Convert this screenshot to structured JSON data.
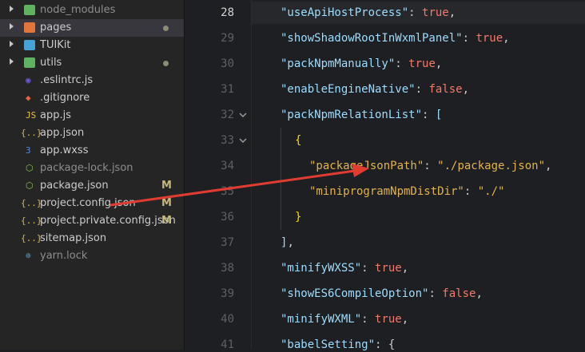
{
  "explorer": {
    "items": [
      {
        "name": "node_modules",
        "kind": "folder",
        "icon": "folder-green-icon",
        "muted": true,
        "expandable": true
      },
      {
        "name": "pages",
        "kind": "folder",
        "icon": "folder-orange-icon",
        "selected": true,
        "expandable": true,
        "dot": true
      },
      {
        "name": "TUIKit",
        "kind": "folder",
        "icon": "folder-blue-icon",
        "expandable": true
      },
      {
        "name": "utils",
        "kind": "folder",
        "icon": "folder-green-icon",
        "expandable": true,
        "dot": true
      },
      {
        "name": ".eslintrc.js",
        "kind": "file",
        "icon": "eslint-icon"
      },
      {
        "name": ".gitignore",
        "kind": "file",
        "icon": "git-icon"
      },
      {
        "name": "app.js",
        "kind": "file",
        "icon": "js-icon"
      },
      {
        "name": "app.json",
        "kind": "file",
        "icon": "json-icon"
      },
      {
        "name": "app.wxss",
        "kind": "file",
        "icon": "css-icon"
      },
      {
        "name": "package-lock.json",
        "kind": "file",
        "icon": "npm-icon",
        "muted": true
      },
      {
        "name": "package.json",
        "kind": "file",
        "icon": "npm-icon",
        "badge": "M"
      },
      {
        "name": "project.config.json",
        "kind": "file",
        "icon": "json-icon",
        "badge": "M"
      },
      {
        "name": "project.private.config.json",
        "kind": "file",
        "icon": "json-icon",
        "badge": "M"
      },
      {
        "name": "sitemap.json",
        "kind": "file",
        "icon": "json-icon"
      },
      {
        "name": "yarn.lock",
        "kind": "file",
        "icon": "yarn-icon",
        "muted": true
      }
    ]
  },
  "editor": {
    "current_line": "28",
    "line_numbers": [
      "28",
      "29",
      "30",
      "31",
      "32",
      "33",
      "34",
      "35",
      "36",
      "37",
      "38",
      "39",
      "40",
      "41"
    ],
    "fold_markers_at": [
      "32",
      "33"
    ],
    "lines": [
      {
        "indent": 0,
        "tokens": [
          {
            "t": "\"useApiHostProcess\"",
            "c": "k"
          },
          {
            "t": ": ",
            "c": "p"
          },
          {
            "t": "true",
            "c": "b"
          },
          {
            "t": ",",
            "c": "p"
          }
        ]
      },
      {
        "indent": 0,
        "tokens": [
          {
            "t": "\"showShadowRootInWxmlPanel\"",
            "c": "k"
          },
          {
            "t": ": ",
            "c": "p"
          },
          {
            "t": "true",
            "c": "b"
          },
          {
            "t": ",",
            "c": "p"
          }
        ]
      },
      {
        "indent": 0,
        "tokens": [
          {
            "t": "\"packNpmManually\"",
            "c": "k"
          },
          {
            "t": ": ",
            "c": "p"
          },
          {
            "t": "true",
            "c": "b"
          },
          {
            "t": ",",
            "c": "p"
          }
        ]
      },
      {
        "indent": 0,
        "tokens": [
          {
            "t": "\"enableEngineNative\"",
            "c": "k"
          },
          {
            "t": ": ",
            "c": "p"
          },
          {
            "t": "false",
            "c": "b"
          },
          {
            "t": ",",
            "c": "p"
          }
        ]
      },
      {
        "indent": 0,
        "tokens": [
          {
            "t": "\"packNpmRelationList\"",
            "c": "k"
          },
          {
            "t": ": ",
            "c": "p"
          },
          {
            "t": "[",
            "c": "k"
          }
        ]
      },
      {
        "indent": 1,
        "tokens": [
          {
            "t": "{",
            "c": "br"
          }
        ]
      },
      {
        "indent": 2,
        "tokens": [
          {
            "t": "\"packageJsonPath\"",
            "c": "sk"
          },
          {
            "t": ": ",
            "c": "p"
          },
          {
            "t": "\"./package.json\"",
            "c": "s"
          },
          {
            "t": ",",
            "c": "p"
          }
        ]
      },
      {
        "indent": 2,
        "tokens": [
          {
            "t": "\"miniprogramNpmDistDir\"",
            "c": "sk"
          },
          {
            "t": ": ",
            "c": "p"
          },
          {
            "t": "\"./\"",
            "c": "s"
          }
        ]
      },
      {
        "indent": 1,
        "tokens": [
          {
            "t": "}",
            "c": "br"
          }
        ]
      },
      {
        "indent": 0,
        "tokens": [
          {
            "t": "]",
            "c": "k"
          },
          {
            "t": ",",
            "c": "p"
          }
        ]
      },
      {
        "indent": 0,
        "tokens": [
          {
            "t": "\"minifyWXSS\"",
            "c": "k"
          },
          {
            "t": ": ",
            "c": "p"
          },
          {
            "t": "true",
            "c": "b"
          },
          {
            "t": ",",
            "c": "p"
          }
        ]
      },
      {
        "indent": 0,
        "tokens": [
          {
            "t": "\"showES6CompileOption\"",
            "c": "k"
          },
          {
            "t": ": ",
            "c": "p"
          },
          {
            "t": "false",
            "c": "b"
          },
          {
            "t": ",",
            "c": "p"
          }
        ]
      },
      {
        "indent": 0,
        "tokens": [
          {
            "t": "\"minifyWXML\"",
            "c": "k"
          },
          {
            "t": ": ",
            "c": "p"
          },
          {
            "t": "true",
            "c": "b"
          },
          {
            "t": ",",
            "c": "p"
          }
        ]
      },
      {
        "indent": 0,
        "tokens": [
          {
            "t": "\"babelSetting\"",
            "c": "k"
          },
          {
            "t": ": ",
            "c": "p"
          },
          {
            "t": "{",
            "c": "p"
          }
        ]
      }
    ]
  },
  "annotation": {
    "color": "#e03c31",
    "from": "project.config.json",
    "to": "packageJsonPath"
  }
}
